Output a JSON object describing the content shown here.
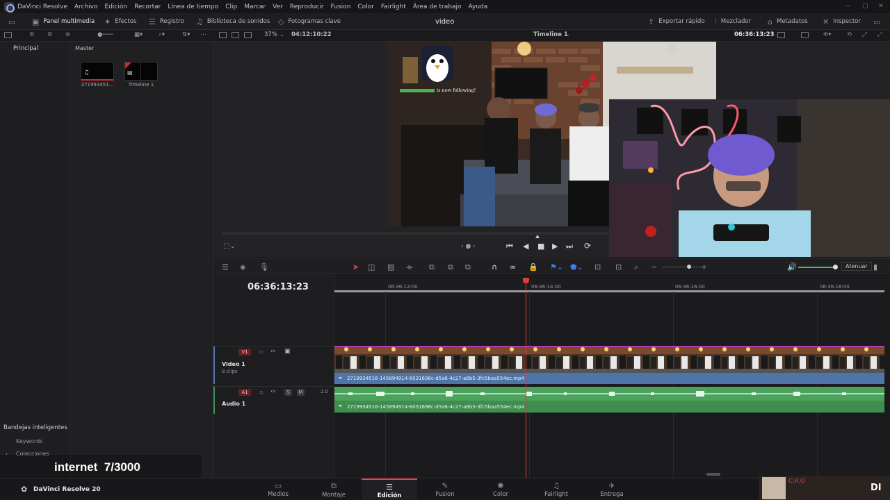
{
  "app": {
    "name": "DaVinci Resolve"
  },
  "menu": [
    "DaVinci Resolve",
    "Archivo",
    "Edición",
    "Recortar",
    "Línea de tiempo",
    "Clip",
    "Marcar",
    "Ver",
    "Reproducir",
    "Fusion",
    "Color",
    "Fairlight",
    "Área de trabajo",
    "Ayuda"
  ],
  "toolbar": {
    "media_pool": "Panel multimedia",
    "effects": "Efectos",
    "index": "Registro",
    "sound_library": "Biblioteca de sonidos",
    "keyframes": "Fotogramas clave",
    "project_title": "video",
    "quick_export": "Exportar rápido",
    "mixer": "Mezclador",
    "metadata": "Metadatos",
    "inspector": "Inspector"
  },
  "subbar": {
    "zoom": "37%",
    "source_timecode": "04:12:10:22",
    "timeline_name": "Timeline 1",
    "record_timecode": "06:36:13:23"
  },
  "bins": {
    "master_header": "Principal",
    "smart_bins": "Bandejas inteligentes",
    "keywords": "Keywords",
    "collections": "Colecciones"
  },
  "media": {
    "header": "Master",
    "items": [
      {
        "label": "271993451..."
      },
      {
        "label": "Timeline 1"
      }
    ]
  },
  "overlay": {
    "follow_text": "is now following!",
    "internet": "internet  7/3000"
  },
  "timeline": {
    "timecode": "06:36:13:23",
    "ticks": [
      "06:36:12:00",
      "06:36:14:00",
      "06:36:16:00",
      "06:36:18:00"
    ],
    "video_track": {
      "tag": "V1",
      "name": "Video 1",
      "clips": "8 clips"
    },
    "audio_track": {
      "tag": "A1",
      "name": "Audio 1",
      "solo": "S",
      "mute": "M",
      "channels": "2.0"
    },
    "clip_name": "2719934516-145894914-6031698c-d5a6-4c27-a8b5-3fc5baa554ec.mp4",
    "dim_label": "Atenuar"
  },
  "pages": [
    {
      "label": "Medios",
      "icon": "media-icon"
    },
    {
      "label": "Montaje",
      "icon": "cut-icon"
    },
    {
      "label": "Edición",
      "icon": "edit-icon",
      "active": true
    },
    {
      "label": "Fusion",
      "icon": "fusion-icon"
    },
    {
      "label": "Color",
      "icon": "color-icon"
    },
    {
      "label": "Fairlight",
      "icon": "fairlight-icon"
    },
    {
      "label": "Entrega",
      "icon": "deliver-icon"
    }
  ],
  "footer": {
    "version": "DaVinci Resolve 20",
    "cam_name": "C.R.O",
    "di_badge": "DI"
  },
  "colors": {
    "accent_red": "#e0464d",
    "clip_blue": "#4f74a8",
    "audio_green": "#3f8e50",
    "playhead": "#e03a3a"
  }
}
